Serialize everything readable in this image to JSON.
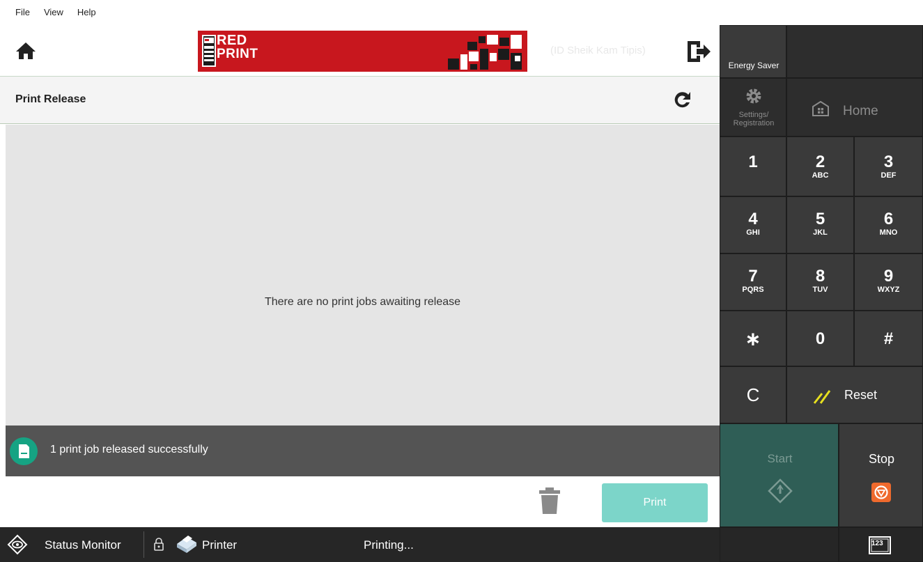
{
  "menu": {
    "file": "File",
    "view": "View",
    "help": "Help"
  },
  "header": {
    "logo_line1": "RED",
    "logo_line2": "PRINT",
    "faded_user": "(ID Sheik Kam Tipis)"
  },
  "page": {
    "title": "Print Release"
  },
  "content": {
    "empty_message": "There are no print jobs awaiting release"
  },
  "notification": {
    "text": "1 print job released successfully"
  },
  "actions": {
    "print_label": "Print"
  },
  "statusbar": {
    "status_monitor": "Status Monitor",
    "printer": "Printer",
    "printing": "Printing..."
  },
  "panel": {
    "energy_saver": "Energy Saver",
    "settings_line1": "Settings/",
    "settings_line2": "Registration",
    "home": "Home",
    "keys": [
      {
        "digit": "1",
        "letters": ""
      },
      {
        "digit": "2",
        "letters": "ABC"
      },
      {
        "digit": "3",
        "letters": "DEF"
      },
      {
        "digit": "4",
        "letters": "GHI"
      },
      {
        "digit": "5",
        "letters": "JKL"
      },
      {
        "digit": "6",
        "letters": "MNO"
      },
      {
        "digit": "7",
        "letters": "PQRS"
      },
      {
        "digit": "8",
        "letters": "TUV"
      },
      {
        "digit": "9",
        "letters": "WXYZ"
      },
      {
        "digit": "∗",
        "letters": ""
      },
      {
        "digit": "0",
        "letters": ""
      },
      {
        "digit": "#",
        "letters": ""
      }
    ],
    "clear": "C",
    "reset": "Reset",
    "start": "Start",
    "stop": "Stop",
    "keyboard": "123"
  },
  "colors": {
    "accent_teal": "#16a383",
    "print_button": "#7cd5c9",
    "start_key": "#2f5e56",
    "stop_icon": "#ef6a2d",
    "brand_red": "#c8171e",
    "reset_slash": "#e6df1f"
  }
}
